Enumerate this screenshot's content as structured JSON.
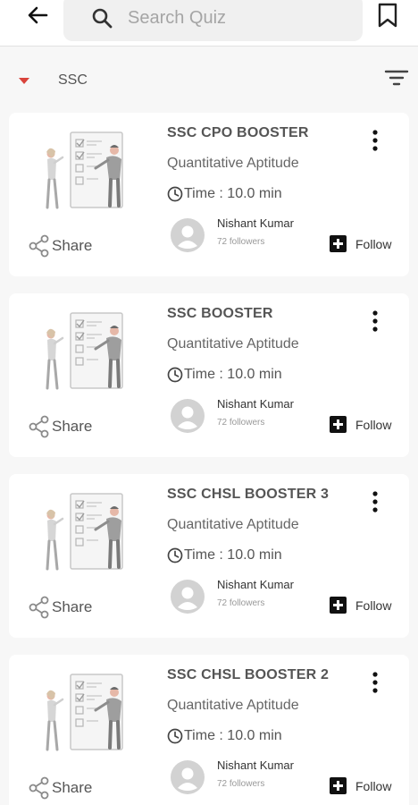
{
  "search": {
    "placeholder": "Search Quiz"
  },
  "filter": {
    "category": "SSC"
  },
  "quizzes": [
    {
      "title": "SSC CPO BOOSTER",
      "subject": "Quantitative Aptitude",
      "time": "Time : 10.0 min",
      "author": "Nishant Kumar",
      "followers": "72 followers",
      "follow_label": "Follow",
      "share_label": "Share"
    },
    {
      "title": "SSC BOOSTER",
      "subject": "Quantitative Aptitude",
      "time": "Time : 10.0 min",
      "author": "Nishant Kumar",
      "followers": "72 followers",
      "follow_label": "Follow",
      "share_label": "Share"
    },
    {
      "title": "SSC CHSL BOOSTER 3",
      "subject": "Quantitative Aptitude",
      "time": "Time : 10.0 min",
      "author": "Nishant Kumar",
      "followers": "72 followers",
      "follow_label": "Follow",
      "share_label": "Share"
    },
    {
      "title": "SSC CHSL BOOSTER 2",
      "subject": "Quantitative Aptitude",
      "time": "Time : 10.0 min",
      "author": "Nishant Kumar",
      "followers": "72 followers",
      "follow_label": "Follow",
      "share_label": "Share"
    }
  ],
  "icons": {
    "back": "arrow-left-icon",
    "search": "search-icon",
    "bookmark": "bookmark-icon",
    "caret": "caret-down-icon",
    "filter": "filter-icon",
    "share": "share-icon",
    "clock": "clock-icon",
    "menu": "more-vertical-icon",
    "avatar": "avatar-placeholder-icon",
    "follow": "plus-square-icon"
  },
  "colors": {
    "accent": "#d9433b",
    "background": "#f7f7f7",
    "card": "#ffffff"
  }
}
